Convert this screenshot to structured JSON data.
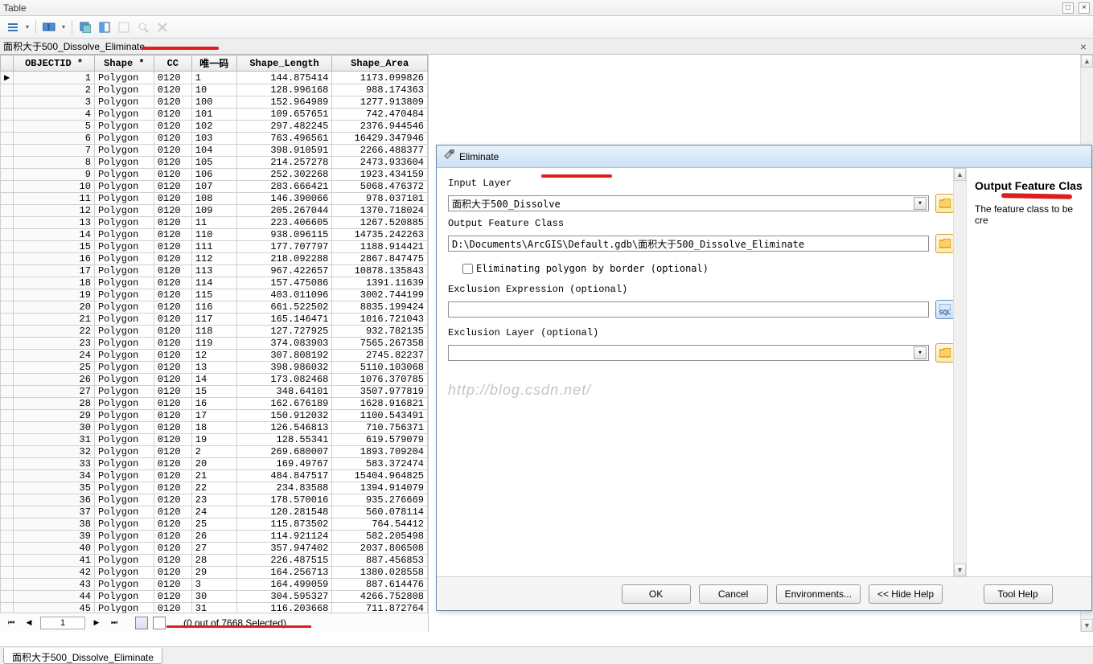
{
  "window": {
    "title": "Table"
  },
  "tab": {
    "name": "面积大于500_Dissolve_Eliminate"
  },
  "columns": [
    "OBJECTID *",
    "Shape *",
    "CC",
    "唯一码",
    "Shape_Length",
    "Shape_Area"
  ],
  "rows": [
    {
      "id": 1,
      "shape": "Polygon",
      "cc": "0120",
      "u": "1",
      "len": "144.875414",
      "area": "1173.099826",
      "sel": "▶"
    },
    {
      "id": 2,
      "shape": "Polygon",
      "cc": "0120",
      "u": "10",
      "len": "128.996168",
      "area": "988.174363"
    },
    {
      "id": 3,
      "shape": "Polygon",
      "cc": "0120",
      "u": "100",
      "len": "152.964989",
      "area": "1277.913809"
    },
    {
      "id": 4,
      "shape": "Polygon",
      "cc": "0120",
      "u": "101",
      "len": "109.657651",
      "area": "742.470484"
    },
    {
      "id": 5,
      "shape": "Polygon",
      "cc": "0120",
      "u": "102",
      "len": "297.482245",
      "area": "2376.944546"
    },
    {
      "id": 6,
      "shape": "Polygon",
      "cc": "0120",
      "u": "103",
      "len": "763.496561",
      "area": "16429.347946"
    },
    {
      "id": 7,
      "shape": "Polygon",
      "cc": "0120",
      "u": "104",
      "len": "398.910591",
      "area": "2266.488377"
    },
    {
      "id": 8,
      "shape": "Polygon",
      "cc": "0120",
      "u": "105",
      "len": "214.257278",
      "area": "2473.933604"
    },
    {
      "id": 9,
      "shape": "Polygon",
      "cc": "0120",
      "u": "106",
      "len": "252.302268",
      "area": "1923.434159"
    },
    {
      "id": 10,
      "shape": "Polygon",
      "cc": "0120",
      "u": "107",
      "len": "283.666421",
      "area": "5068.476372"
    },
    {
      "id": 11,
      "shape": "Polygon",
      "cc": "0120",
      "u": "108",
      "len": "146.390066",
      "area": "978.037101"
    },
    {
      "id": 12,
      "shape": "Polygon",
      "cc": "0120",
      "u": "109",
      "len": "205.267044",
      "area": "1370.718024"
    },
    {
      "id": 13,
      "shape": "Polygon",
      "cc": "0120",
      "u": "11",
      "len": "223.406605",
      "area": "1267.520885"
    },
    {
      "id": 14,
      "shape": "Polygon",
      "cc": "0120",
      "u": "110",
      "len": "938.096115",
      "area": "14735.242263"
    },
    {
      "id": 15,
      "shape": "Polygon",
      "cc": "0120",
      "u": "111",
      "len": "177.707797",
      "area": "1188.914421"
    },
    {
      "id": 16,
      "shape": "Polygon",
      "cc": "0120",
      "u": "112",
      "len": "218.092288",
      "area": "2867.847475"
    },
    {
      "id": 17,
      "shape": "Polygon",
      "cc": "0120",
      "u": "113",
      "len": "967.422657",
      "area": "10878.135843"
    },
    {
      "id": 18,
      "shape": "Polygon",
      "cc": "0120",
      "u": "114",
      "len": "157.475086",
      "area": "1391.11639"
    },
    {
      "id": 19,
      "shape": "Polygon",
      "cc": "0120",
      "u": "115",
      "len": "403.011096",
      "area": "3002.744199"
    },
    {
      "id": 20,
      "shape": "Polygon",
      "cc": "0120",
      "u": "116",
      "len": "661.522502",
      "area": "8835.199424"
    },
    {
      "id": 21,
      "shape": "Polygon",
      "cc": "0120",
      "u": "117",
      "len": "165.146471",
      "area": "1016.721043"
    },
    {
      "id": 22,
      "shape": "Polygon",
      "cc": "0120",
      "u": "118",
      "len": "127.727925",
      "area": "932.782135"
    },
    {
      "id": 23,
      "shape": "Polygon",
      "cc": "0120",
      "u": "119",
      "len": "374.083903",
      "area": "7565.267358"
    },
    {
      "id": 24,
      "shape": "Polygon",
      "cc": "0120",
      "u": "12",
      "len": "307.808192",
      "area": "2745.82237"
    },
    {
      "id": 25,
      "shape": "Polygon",
      "cc": "0120",
      "u": "13",
      "len": "398.986032",
      "area": "5110.103068"
    },
    {
      "id": 26,
      "shape": "Polygon",
      "cc": "0120",
      "u": "14",
      "len": "173.082468",
      "area": "1076.370785"
    },
    {
      "id": 27,
      "shape": "Polygon",
      "cc": "0120",
      "u": "15",
      "len": "348.64101",
      "area": "3507.977819"
    },
    {
      "id": 28,
      "shape": "Polygon",
      "cc": "0120",
      "u": "16",
      "len": "162.676189",
      "area": "1628.916821"
    },
    {
      "id": 29,
      "shape": "Polygon",
      "cc": "0120",
      "u": "17",
      "len": "150.912032",
      "area": "1100.543491"
    },
    {
      "id": 30,
      "shape": "Polygon",
      "cc": "0120",
      "u": "18",
      "len": "126.546813",
      "area": "710.756371"
    },
    {
      "id": 31,
      "shape": "Polygon",
      "cc": "0120",
      "u": "19",
      "len": "128.55341",
      "area": "619.579079"
    },
    {
      "id": 32,
      "shape": "Polygon",
      "cc": "0120",
      "u": "2",
      "len": "269.680007",
      "area": "1893.709204"
    },
    {
      "id": 33,
      "shape": "Polygon",
      "cc": "0120",
      "u": "20",
      "len": "169.49767",
      "area": "583.372474"
    },
    {
      "id": 34,
      "shape": "Polygon",
      "cc": "0120",
      "u": "21",
      "len": "484.847517",
      "area": "15404.964825"
    },
    {
      "id": 35,
      "shape": "Polygon",
      "cc": "0120",
      "u": "22",
      "len": "234.83588",
      "area": "1394.914079"
    },
    {
      "id": 36,
      "shape": "Polygon",
      "cc": "0120",
      "u": "23",
      "len": "178.570016",
      "area": "935.276669"
    },
    {
      "id": 37,
      "shape": "Polygon",
      "cc": "0120",
      "u": "24",
      "len": "120.281548",
      "area": "560.078114"
    },
    {
      "id": 38,
      "shape": "Polygon",
      "cc": "0120",
      "u": "25",
      "len": "115.873502",
      "area": "764.54412"
    },
    {
      "id": 39,
      "shape": "Polygon",
      "cc": "0120",
      "u": "26",
      "len": "114.921124",
      "area": "582.205498"
    },
    {
      "id": 40,
      "shape": "Polygon",
      "cc": "0120",
      "u": "27",
      "len": "357.947402",
      "area": "2037.806508"
    },
    {
      "id": 41,
      "shape": "Polygon",
      "cc": "0120",
      "u": "28",
      "len": "226.487515",
      "area": "887.456853"
    },
    {
      "id": 42,
      "shape": "Polygon",
      "cc": "0120",
      "u": "29",
      "len": "164.256713",
      "area": "1380.028558"
    },
    {
      "id": 43,
      "shape": "Polygon",
      "cc": "0120",
      "u": "3",
      "len": "164.499059",
      "area": "887.614476"
    },
    {
      "id": 44,
      "shape": "Polygon",
      "cc": "0120",
      "u": "30",
      "len": "304.595327",
      "area": "4266.752808"
    },
    {
      "id": 45,
      "shape": "Polygon",
      "cc": "0120",
      "u": "31",
      "len": "116.203668",
      "area": "711.872764"
    }
  ],
  "nav": {
    "pos": "1",
    "status": "(0 out of 7668 Selected)"
  },
  "bottom_tab": "面积大于500_Dissolve_Eliminate",
  "dialog": {
    "title": "Eliminate",
    "input_layer_label": "Input Layer",
    "input_layer_value": "面积大于500_Dissolve",
    "output_fc_label": "Output Feature Class",
    "output_fc_value": "D:\\Documents\\ArcGIS\\Default.gdb\\面积大于500_Dissolve_Eliminate",
    "elim_border": "Eliminating polygon by border (optional)",
    "excl_expr_label": "Exclusion Expression (optional)",
    "excl_layer_label": "Exclusion Layer (optional)",
    "watermark": "http://blog.csdn.net/",
    "buttons": {
      "ok": "OK",
      "cancel": "Cancel",
      "env": "Environments...",
      "hide": "<< Hide Help",
      "toolhelp": "Tool Help"
    },
    "help_title": "Output Feature Clas",
    "help_body": "The feature class to be cre"
  }
}
